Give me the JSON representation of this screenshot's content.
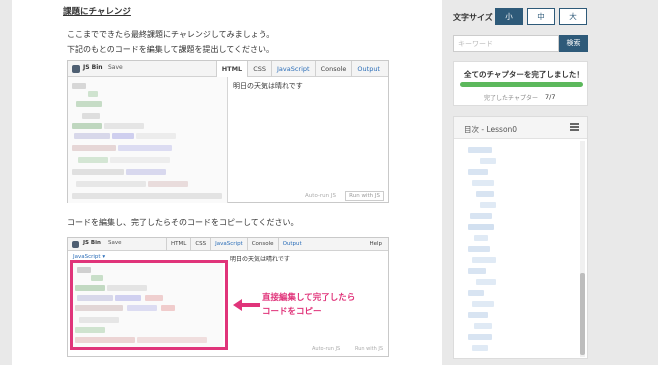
{
  "lesson": {
    "section_title": "課題にチャレンジ",
    "intro_line1": "ここまでできたら最終課題にチャレンジしてみましょう。",
    "intro_line2": "下記のもとのコードを編集して課題を提出してください。",
    "instruction": "コードを編集し、完了したらそのコードをコピーしてください。"
  },
  "jsbin1": {
    "name": "JS Bin",
    "save": "Save",
    "tabs": [
      "HTML",
      "CSS",
      "JavaScript",
      "Console",
      "Output"
    ],
    "output_text": "明日の天気は晴れです",
    "autorun": "Auto-run JS",
    "run": "Run with JS"
  },
  "jsbin2": {
    "name": "JS Bin",
    "save": "Save",
    "tabs": [
      "HTML",
      "CSS",
      "JavaScript",
      "Console",
      "Output"
    ],
    "help": "Help",
    "lang": "JavaScript ▾",
    "output_text": "明日の天気は晴れです",
    "autorun": "Auto-run JS",
    "run": "Run with JS",
    "callout_line1": "直接編集して完了したら",
    "callout_line2": "コードをコピー"
  },
  "sidebar": {
    "font_size_label": "文字サイズ",
    "font_small": "小",
    "font_medium": "中",
    "font_large": "大",
    "search_placeholder": "キーワード",
    "search_button": "検索",
    "complete_title": "全てのチャプターを完了しました！",
    "progress_label": "完了したチャプター",
    "progress_count": "7/7",
    "progress_fraction": 1.0,
    "toc_title": "目次 - Lesson0"
  },
  "colors": {
    "accent": "#2e5a79",
    "highlight": "#e0347a",
    "progress": "#5cb85c"
  }
}
